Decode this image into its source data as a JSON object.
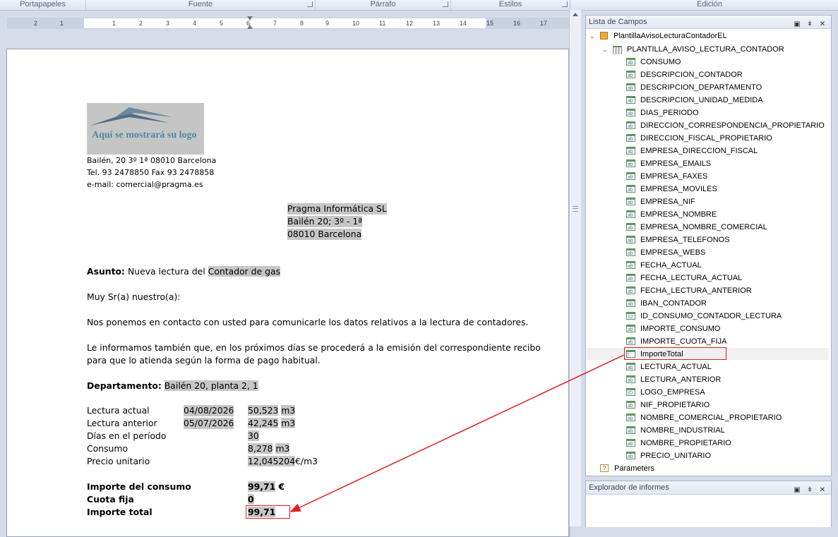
{
  "ribbon": {
    "groups": [
      "Portapapeles",
      "Fuente",
      "Párrafo",
      "Estilos",
      "Edición"
    ]
  },
  "ruler": {
    "ticks": [
      "2",
      "1",
      "1",
      "2",
      "3",
      "4",
      "5",
      "6",
      "7",
      "8",
      "9",
      "10",
      "11",
      "12",
      "13",
      "14",
      "15",
      "16",
      "17"
    ]
  },
  "document": {
    "company_info": {
      "logo_text": "Aquí se mostrará su logo",
      "address": "Bailén, 20 3º 1ª 08010 Barcelona",
      "phone": "Tel. 93 2478850 Fax 93 2478858",
      "email": "e-mail: comercial@pragma.es"
    },
    "recipient": {
      "name": "Pragma Informática SL",
      "street": "Bailén 20; 3º - 1ª",
      "city": "08010 Barcelona"
    },
    "subject_label": "Asunto:",
    "subject_text": "Nueva lectura del",
    "subject_field": "Contador de gas",
    "greeting": "Muy Sr(a) nuestro(a):",
    "paragraph1": "Nos ponemos en contacto con usted para comunicarle los datos relativos a la lectura de contadores.",
    "paragraph2_line1": "Le informamos también que, en los próximos días se procederá a la emisión del correspondiente recibo",
    "paragraph2_line2": "para que lo atienda según la forma de pago habitual.",
    "department_label": "Departamento:",
    "department_value": "Bailén 20, planta 2, 1",
    "readings": [
      {
        "label": "Lectura actual",
        "date": "04/08/2026",
        "value": "50,523",
        "unit": "m3"
      },
      {
        "label": "Lectura anterior",
        "date": "05/07/2026",
        "value": "42,245",
        "unit": "m3"
      },
      {
        "label": "Días en el período",
        "date": "",
        "value": "30",
        "unit": ""
      },
      {
        "label": "Consumo",
        "date": "",
        "value": "8,278",
        "unit": "m3"
      },
      {
        "label": "Precio unitario",
        "date": "",
        "value": "12,045204",
        "unit": "€/m3"
      }
    ],
    "totals": [
      {
        "label": "Importe del consumo",
        "value": "99,71",
        "unit": "€"
      },
      {
        "label": "Cuota fija",
        "value": "0",
        "unit": ""
      },
      {
        "label": "Importe total",
        "value": "99,71",
        "unit": ""
      }
    ]
  },
  "field_list": {
    "title": "Lista de Campos",
    "root": "PlantillaAvisoLecturaContadorEL",
    "table": "PLANTILLA_AVISO_LECTURA_CONTADOR",
    "fields": [
      {
        "name": "CONSUMO",
        "icon": "ab"
      },
      {
        "name": "DESCRIPCION_CONTADOR",
        "icon": "ab"
      },
      {
        "name": "DESCRIPCION_DEPARTAMENTO",
        "icon": "ab"
      },
      {
        "name": "DESCRIPCION_UNIDAD_MEDIDA",
        "icon": "ab"
      },
      {
        "name": "DIAS_PERIODO",
        "icon": "ab"
      },
      {
        "name": "DIRECCION_CORRESPONDENCIA_PROPIETARIO",
        "icon": "ab"
      },
      {
        "name": "DIRECCION_FISCAL_PROPIETARIO",
        "icon": "ab"
      },
      {
        "name": "EMPRESA_DIRECCION_FISCAL",
        "icon": "ab"
      },
      {
        "name": "EMPRESA_EMAILS",
        "icon": "ab"
      },
      {
        "name": "EMPRESA_FAXES",
        "icon": "ab"
      },
      {
        "name": "EMPRESA_MOVILES",
        "icon": "ab"
      },
      {
        "name": "EMPRESA_NIF",
        "icon": "ab"
      },
      {
        "name": "EMPRESA_NOMBRE",
        "icon": "ab"
      },
      {
        "name": "EMPRESA_NOMBRE_COMERCIAL",
        "icon": "ab"
      },
      {
        "name": "EMPRESA_TELEFONOS",
        "icon": "ab"
      },
      {
        "name": "EMPRESA_WEBS",
        "icon": "ab"
      },
      {
        "name": "FECHA_ACTUAL",
        "icon": "ab"
      },
      {
        "name": "FECHA_LECTURA_ACTUAL",
        "icon": "ab"
      },
      {
        "name": "FECHA_LECTURA_ANTERIOR",
        "icon": "ab"
      },
      {
        "name": "IBAN_CONTADOR",
        "icon": "ab"
      },
      {
        "name": "ID_CONSUMO_CONTADOR_LECTURA",
        "icon": "12"
      },
      {
        "name": "IMPORTE_CONSUMO",
        "icon": "ab"
      },
      {
        "name": "IMPORTE_CUOTA_FIJA",
        "icon": "ab"
      },
      {
        "name": "ImporteTotal",
        "icon": "f"
      },
      {
        "name": "LECTURA_ACTUAL",
        "icon": "ab"
      },
      {
        "name": "LECTURA_ANTERIOR",
        "icon": "ab"
      },
      {
        "name": "LOGO_EMPRESA",
        "icon": "ID"
      },
      {
        "name": "NIF_PROPIETARIO",
        "icon": "ab"
      },
      {
        "name": "NOMBRE_COMERCIAL_PROPIETARIO",
        "icon": "ab"
      },
      {
        "name": "NOMBRE_INDUSTRIAL",
        "icon": "ab"
      },
      {
        "name": "NOMBRE_PROPIETARIO",
        "icon": "ab"
      },
      {
        "name": "PRECIO_UNITARIO",
        "icon": "ab"
      }
    ],
    "parameters": "Parameters"
  },
  "report_explorer": {
    "title": "Explorador de informes"
  },
  "colors": {
    "highlight": "#e02020",
    "field_background": "#c6c6c6"
  }
}
